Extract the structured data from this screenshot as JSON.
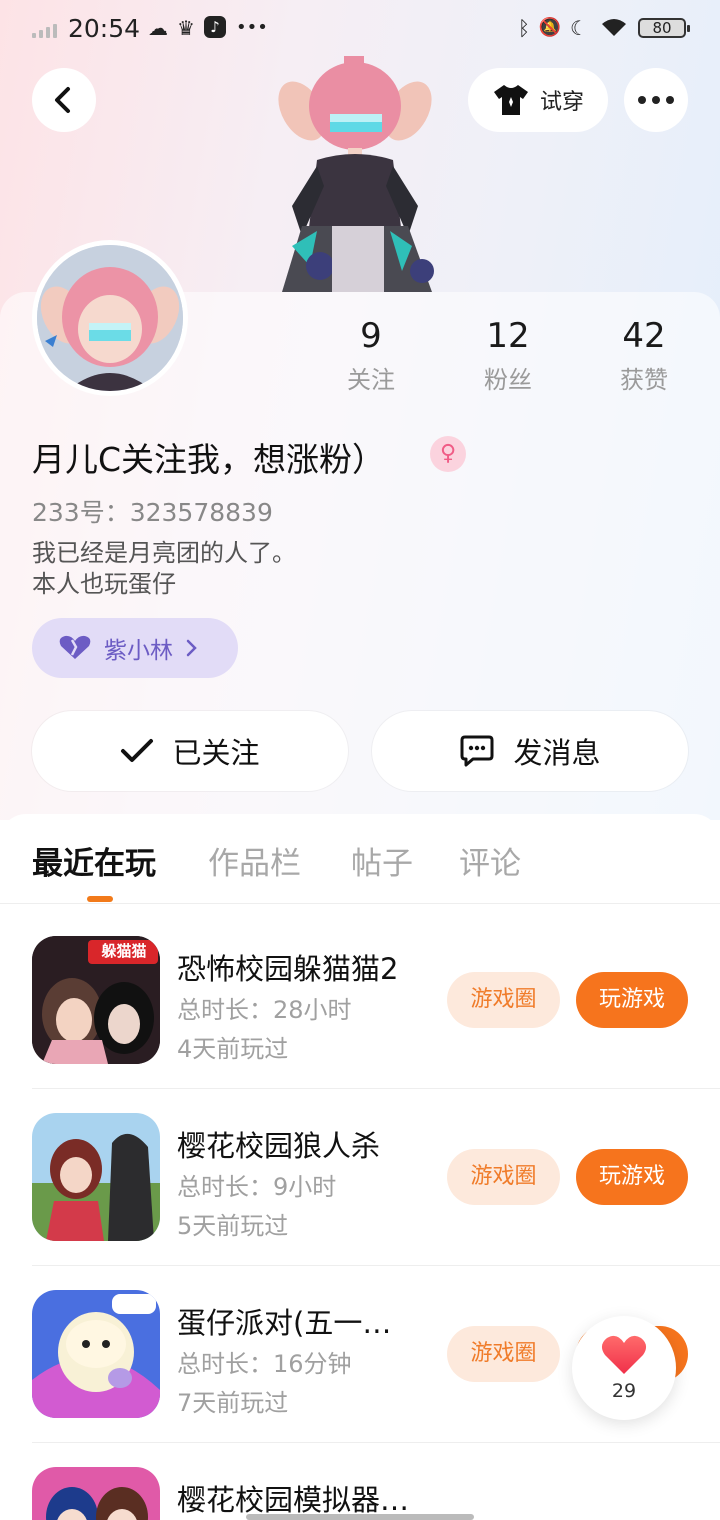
{
  "status_bar": {
    "time": "20:54",
    "battery": "80",
    "icons": [
      "signal-icon",
      "cloud-icon",
      "crown-icon",
      "music-app-icon",
      "more-dots-icon",
      "bluetooth-icon",
      "mute-bell-icon",
      "moon-icon",
      "wifi-icon",
      "battery-icon"
    ]
  },
  "header": {
    "back_icon": "chevron-left-icon",
    "tryon_label": "试穿",
    "tryon_icon": "shirt-icon",
    "more_icon": "more-dots-icon"
  },
  "profile": {
    "stats": [
      {
        "value": "9",
        "label": "关注"
      },
      {
        "value": "12",
        "label": "粉丝"
      },
      {
        "value": "42",
        "label": "获赞"
      }
    ],
    "nickname": "月儿C关注我，想涨粉）",
    "gender_icon": "female-icon",
    "user_id": "233号：323578839",
    "bio_lines": [
      "我已经是月亮团的人了。",
      "本人也玩蛋仔"
    ],
    "guild_tag": "紫小林",
    "guild_color": "#6c5cc4"
  },
  "actions": {
    "followed_label": "已关注",
    "message_label": "发消息"
  },
  "tabs": [
    "最近在玩",
    "作品栏",
    "帖子",
    "评论"
  ],
  "active_tab": 0,
  "accent_color": "#f6741d",
  "games": [
    {
      "title": "恐怖校园躲猫猫2",
      "duration": "总时长：28小时",
      "last_played": "4天前玩过",
      "circle_label": "游戏圈",
      "play_label": "玩游戏"
    },
    {
      "title": "樱花校园狼人杀",
      "duration": "总时长：9小时",
      "last_played": "5天前玩过",
      "circle_label": "游戏圈",
      "play_label": "玩游戏"
    },
    {
      "title": "蛋仔派对(五一…",
      "duration": "总时长：16分钟",
      "last_played": "7天前玩过",
      "circle_label": "游戏圈",
      "play_label": "玩游戏"
    },
    {
      "title": "樱花校园模拟器…",
      "duration": "",
      "last_played": "",
      "circle_label": "",
      "play_label": ""
    }
  ],
  "game_icon_text": "躲猫猫",
  "like": {
    "count": "29",
    "icon": "heart-icon"
  }
}
